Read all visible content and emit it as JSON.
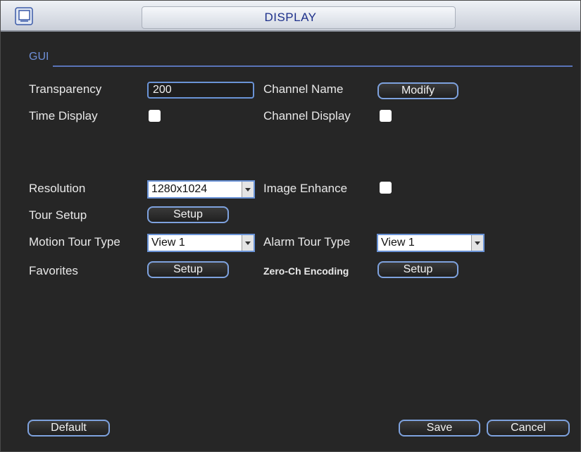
{
  "window": {
    "title": "DISPLAY"
  },
  "gui_section": {
    "label": "GUI"
  },
  "transparency": {
    "label": "Transparency",
    "value": "200"
  },
  "channel_name": {
    "label": "Channel Name",
    "button": "Modify"
  },
  "time_display": {
    "label": "Time Display",
    "checked": true
  },
  "channel_display": {
    "label": "Channel Display",
    "checked": true
  },
  "resolution": {
    "label": "Resolution",
    "value": "1280x1024"
  },
  "image_enhance": {
    "label": "Image Enhance",
    "checked": true
  },
  "tour_setup": {
    "label": "Tour Setup",
    "button": "Setup"
  },
  "motion_tour_type": {
    "label": "Motion Tour Type",
    "value": "View 1"
  },
  "alarm_tour_type": {
    "label": "Alarm Tour Type",
    "value": "View 1"
  },
  "favorites": {
    "label": "Favorites",
    "button": "Setup"
  },
  "zero_ch_encoding": {
    "label": "Zero-Ch Encoding",
    "button": "Setup"
  },
  "footer": {
    "default": "Default",
    "save": "Save",
    "cancel": "Cancel"
  },
  "icons": {
    "window_icon": "monitor-window-icon",
    "dropdown": "chevron-down-icon"
  }
}
